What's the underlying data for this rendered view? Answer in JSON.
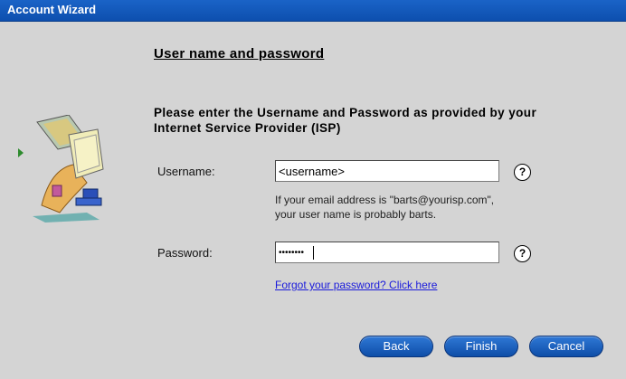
{
  "window": {
    "title": "Account Wizard"
  },
  "page": {
    "heading": "User name and password",
    "intro": "Please enter the Username and Password as provided by your Internet Service Provider (ISP)"
  },
  "username": {
    "label": "Username:",
    "value": "<username>",
    "hint_line1": "If your email address is \"barts@yourisp.com\",",
    "hint_line2": "your user name is probably barts."
  },
  "password": {
    "label": "Password:",
    "value": "••••••••"
  },
  "help": {
    "glyph": "?"
  },
  "forgot": {
    "label": "Forgot your password? Click here"
  },
  "buttons": {
    "back": "Back",
    "finish": "Finish",
    "cancel": "Cancel"
  },
  "colors": {
    "titlebar": "#1a63c7",
    "button": "#1a5fbf",
    "link": "#1a1adb",
    "background": "#d4d4d4"
  },
  "icons": {
    "caret": "green-caret-icon",
    "illustration": "computer-setup-illustration"
  }
}
